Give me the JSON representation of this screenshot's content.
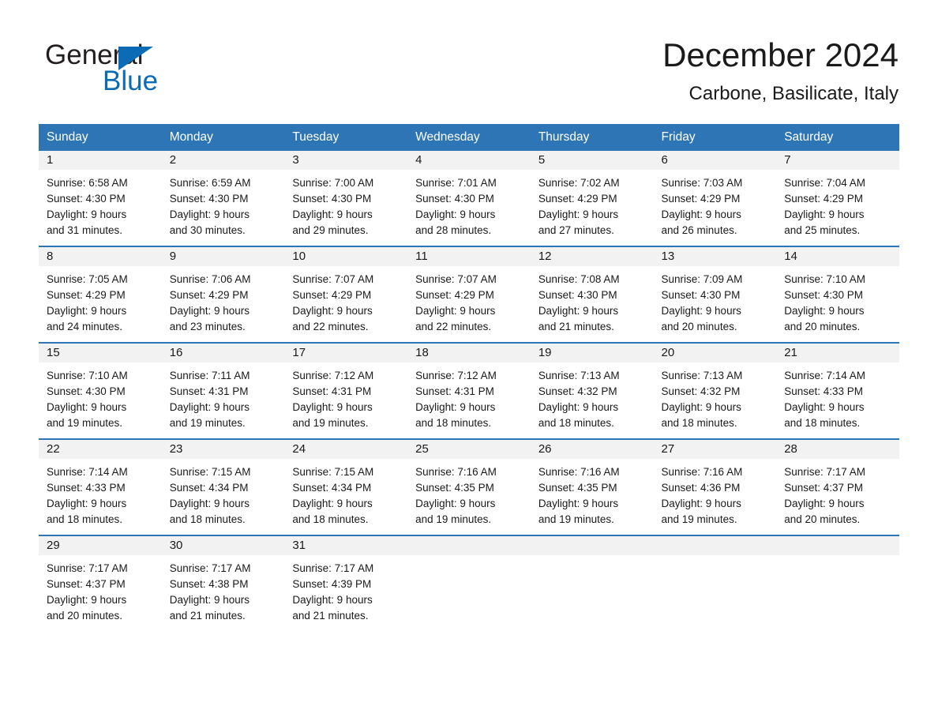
{
  "brand": {
    "name_part1": "General",
    "name_part2": "Blue",
    "triangle_icon": "brand-triangle-icon",
    "accent_color": "#0b6cb5"
  },
  "header": {
    "month_title": "December 2024",
    "location": "Carbone, Basilicate, Italy"
  },
  "theme": {
    "header_blue": "#2e75b6",
    "daynum_band": "#f2f2f2",
    "text": "#1a1a1a"
  },
  "calendar": {
    "weekday_headers": [
      "Sunday",
      "Monday",
      "Tuesday",
      "Wednesday",
      "Thursday",
      "Friday",
      "Saturday"
    ],
    "weeks": [
      [
        {
          "day": "1",
          "sunrise": "Sunrise: 6:58 AM",
          "sunset": "Sunset: 4:30 PM",
          "daylight_1": "Daylight: 9 hours",
          "daylight_2": "and 31 minutes."
        },
        {
          "day": "2",
          "sunrise": "Sunrise: 6:59 AM",
          "sunset": "Sunset: 4:30 PM",
          "daylight_1": "Daylight: 9 hours",
          "daylight_2": "and 30 minutes."
        },
        {
          "day": "3",
          "sunrise": "Sunrise: 7:00 AM",
          "sunset": "Sunset: 4:30 PM",
          "daylight_1": "Daylight: 9 hours",
          "daylight_2": "and 29 minutes."
        },
        {
          "day": "4",
          "sunrise": "Sunrise: 7:01 AM",
          "sunset": "Sunset: 4:30 PM",
          "daylight_1": "Daylight: 9 hours",
          "daylight_2": "and 28 minutes."
        },
        {
          "day": "5",
          "sunrise": "Sunrise: 7:02 AM",
          "sunset": "Sunset: 4:29 PM",
          "daylight_1": "Daylight: 9 hours",
          "daylight_2": "and 27 minutes."
        },
        {
          "day": "6",
          "sunrise": "Sunrise: 7:03 AM",
          "sunset": "Sunset: 4:29 PM",
          "daylight_1": "Daylight: 9 hours",
          "daylight_2": "and 26 minutes."
        },
        {
          "day": "7",
          "sunrise": "Sunrise: 7:04 AM",
          "sunset": "Sunset: 4:29 PM",
          "daylight_1": "Daylight: 9 hours",
          "daylight_2": "and 25 minutes."
        }
      ],
      [
        {
          "day": "8",
          "sunrise": "Sunrise: 7:05 AM",
          "sunset": "Sunset: 4:29 PM",
          "daylight_1": "Daylight: 9 hours",
          "daylight_2": "and 24 minutes."
        },
        {
          "day": "9",
          "sunrise": "Sunrise: 7:06 AM",
          "sunset": "Sunset: 4:29 PM",
          "daylight_1": "Daylight: 9 hours",
          "daylight_2": "and 23 minutes."
        },
        {
          "day": "10",
          "sunrise": "Sunrise: 7:07 AM",
          "sunset": "Sunset: 4:29 PM",
          "daylight_1": "Daylight: 9 hours",
          "daylight_2": "and 22 minutes."
        },
        {
          "day": "11",
          "sunrise": "Sunrise: 7:07 AM",
          "sunset": "Sunset: 4:29 PM",
          "daylight_1": "Daylight: 9 hours",
          "daylight_2": "and 22 minutes."
        },
        {
          "day": "12",
          "sunrise": "Sunrise: 7:08 AM",
          "sunset": "Sunset: 4:30 PM",
          "daylight_1": "Daylight: 9 hours",
          "daylight_2": "and 21 minutes."
        },
        {
          "day": "13",
          "sunrise": "Sunrise: 7:09 AM",
          "sunset": "Sunset: 4:30 PM",
          "daylight_1": "Daylight: 9 hours",
          "daylight_2": "and 20 minutes."
        },
        {
          "day": "14",
          "sunrise": "Sunrise: 7:10 AM",
          "sunset": "Sunset: 4:30 PM",
          "daylight_1": "Daylight: 9 hours",
          "daylight_2": "and 20 minutes."
        }
      ],
      [
        {
          "day": "15",
          "sunrise": "Sunrise: 7:10 AM",
          "sunset": "Sunset: 4:30 PM",
          "daylight_1": "Daylight: 9 hours",
          "daylight_2": "and 19 minutes."
        },
        {
          "day": "16",
          "sunrise": "Sunrise: 7:11 AM",
          "sunset": "Sunset: 4:31 PM",
          "daylight_1": "Daylight: 9 hours",
          "daylight_2": "and 19 minutes."
        },
        {
          "day": "17",
          "sunrise": "Sunrise: 7:12 AM",
          "sunset": "Sunset: 4:31 PM",
          "daylight_1": "Daylight: 9 hours",
          "daylight_2": "and 19 minutes."
        },
        {
          "day": "18",
          "sunrise": "Sunrise: 7:12 AM",
          "sunset": "Sunset: 4:31 PM",
          "daylight_1": "Daylight: 9 hours",
          "daylight_2": "and 18 minutes."
        },
        {
          "day": "19",
          "sunrise": "Sunrise: 7:13 AM",
          "sunset": "Sunset: 4:32 PM",
          "daylight_1": "Daylight: 9 hours",
          "daylight_2": "and 18 minutes."
        },
        {
          "day": "20",
          "sunrise": "Sunrise: 7:13 AM",
          "sunset": "Sunset: 4:32 PM",
          "daylight_1": "Daylight: 9 hours",
          "daylight_2": "and 18 minutes."
        },
        {
          "day": "21",
          "sunrise": "Sunrise: 7:14 AM",
          "sunset": "Sunset: 4:33 PM",
          "daylight_1": "Daylight: 9 hours",
          "daylight_2": "and 18 minutes."
        }
      ],
      [
        {
          "day": "22",
          "sunrise": "Sunrise: 7:14 AM",
          "sunset": "Sunset: 4:33 PM",
          "daylight_1": "Daylight: 9 hours",
          "daylight_2": "and 18 minutes."
        },
        {
          "day": "23",
          "sunrise": "Sunrise: 7:15 AM",
          "sunset": "Sunset: 4:34 PM",
          "daylight_1": "Daylight: 9 hours",
          "daylight_2": "and 18 minutes."
        },
        {
          "day": "24",
          "sunrise": "Sunrise: 7:15 AM",
          "sunset": "Sunset: 4:34 PM",
          "daylight_1": "Daylight: 9 hours",
          "daylight_2": "and 18 minutes."
        },
        {
          "day": "25",
          "sunrise": "Sunrise: 7:16 AM",
          "sunset": "Sunset: 4:35 PM",
          "daylight_1": "Daylight: 9 hours",
          "daylight_2": "and 19 minutes."
        },
        {
          "day": "26",
          "sunrise": "Sunrise: 7:16 AM",
          "sunset": "Sunset: 4:35 PM",
          "daylight_1": "Daylight: 9 hours",
          "daylight_2": "and 19 minutes."
        },
        {
          "day": "27",
          "sunrise": "Sunrise: 7:16 AM",
          "sunset": "Sunset: 4:36 PM",
          "daylight_1": "Daylight: 9 hours",
          "daylight_2": "and 19 minutes."
        },
        {
          "day": "28",
          "sunrise": "Sunrise: 7:17 AM",
          "sunset": "Sunset: 4:37 PM",
          "daylight_1": "Daylight: 9 hours",
          "daylight_2": "and 20 minutes."
        }
      ],
      [
        {
          "day": "29",
          "sunrise": "Sunrise: 7:17 AM",
          "sunset": "Sunset: 4:37 PM",
          "daylight_1": "Daylight: 9 hours",
          "daylight_2": "and 20 minutes."
        },
        {
          "day": "30",
          "sunrise": "Sunrise: 7:17 AM",
          "sunset": "Sunset: 4:38 PM",
          "daylight_1": "Daylight: 9 hours",
          "daylight_2": "and 21 minutes."
        },
        {
          "day": "31",
          "sunrise": "Sunrise: 7:17 AM",
          "sunset": "Sunset: 4:39 PM",
          "daylight_1": "Daylight: 9 hours",
          "daylight_2": "and 21 minutes."
        },
        {
          "day": "",
          "sunrise": "",
          "sunset": "",
          "daylight_1": "",
          "daylight_2": ""
        },
        {
          "day": "",
          "sunrise": "",
          "sunset": "",
          "daylight_1": "",
          "daylight_2": ""
        },
        {
          "day": "",
          "sunrise": "",
          "sunset": "",
          "daylight_1": "",
          "daylight_2": ""
        },
        {
          "day": "",
          "sunrise": "",
          "sunset": "",
          "daylight_1": "",
          "daylight_2": ""
        }
      ]
    ]
  }
}
